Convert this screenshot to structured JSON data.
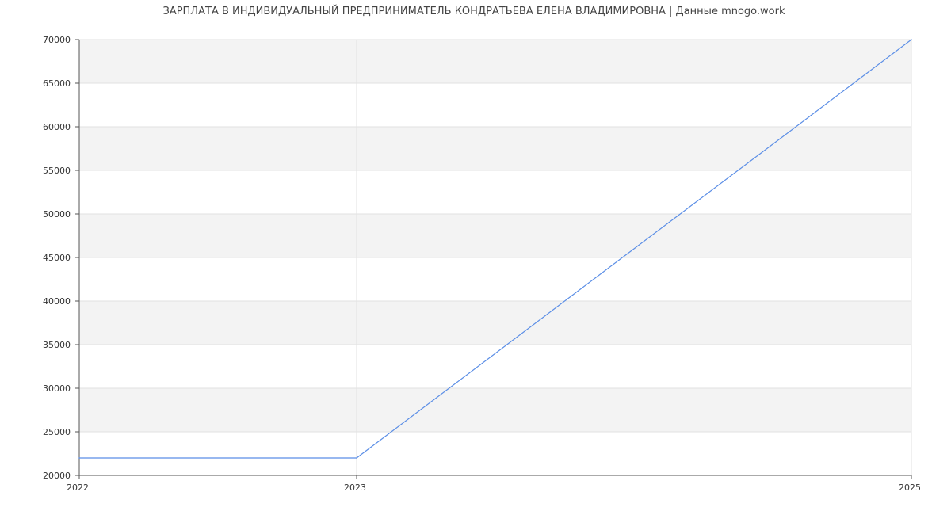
{
  "chart_data": {
    "type": "line",
    "title": "ЗАРПЛАТА В ИНДИВИДУАЛЬНЫЙ ПРЕДПРИНИМАТЕЛЬ КОНДРАТЬЕВА ЕЛЕНА ВЛАДИМИРОВНА | Данные mnogo.work",
    "xlabel": "",
    "ylabel": "",
    "x_ticks": [
      "2022",
      "2023",
      "2025"
    ],
    "y_ticks": [
      "20000",
      "25000",
      "30000",
      "35000",
      "40000",
      "45000",
      "50000",
      "55000",
      "60000",
      "65000",
      "70000"
    ],
    "ylim": [
      20000,
      70000
    ],
    "grid": true,
    "legend": "none",
    "series": [
      {
        "color": "#5b8ee6",
        "points": [
          {
            "x": "2022",
            "y": 22000
          },
          {
            "x": "2023",
            "y": 22000
          },
          {
            "x": "2025",
            "y": 70000
          }
        ]
      }
    ],
    "colors": {
      "band": "#f3f3f3",
      "grid": "#e2e2e2",
      "axis": "#555555",
      "line": "#5b8ee6"
    }
  }
}
